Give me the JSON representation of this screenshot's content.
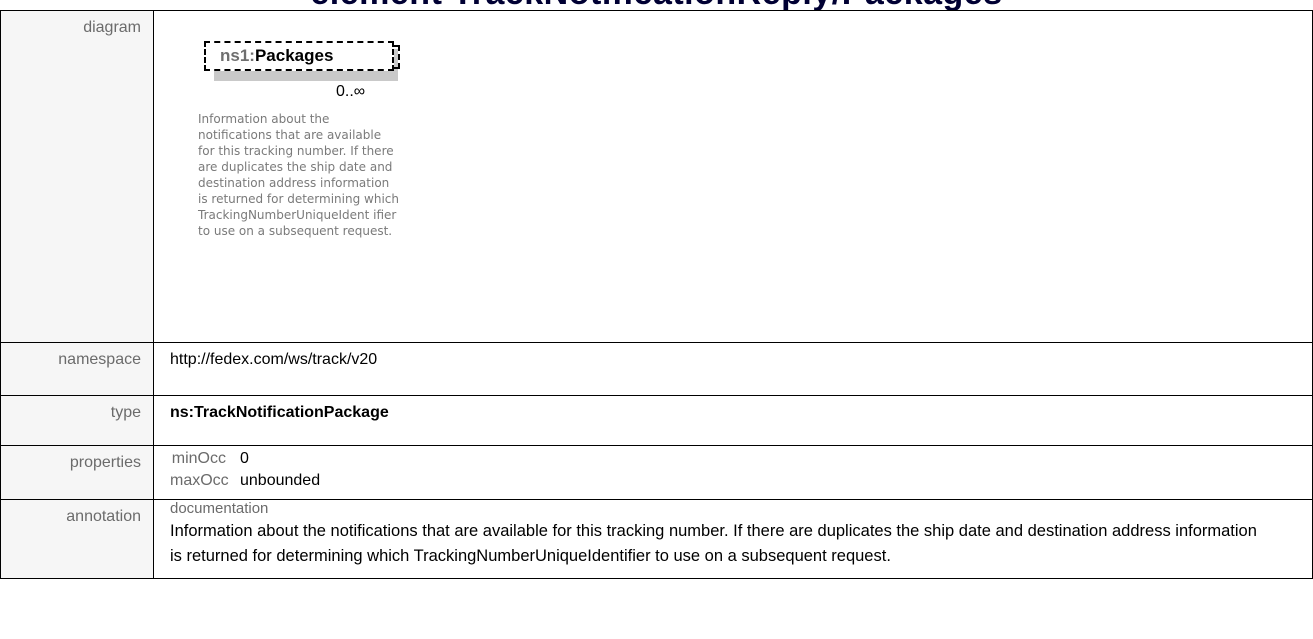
{
  "heading": {
    "prefix": "element TrackNotificationReply/Packages",
    "accent": ""
  },
  "rows": {
    "diagram": {
      "label": "diagram",
      "node_prefix": "ns1:",
      "node_name": "Packages",
      "cardinality": "0..∞",
      "node_doc": "Information about the notifications that are available for this tracking number. If there are duplicates the ship date and destination address information is returned for determining which TrackingNumberUniqueIdent ifier to use on a subsequent request."
    },
    "namespace": {
      "label": "namespace",
      "value": "http://fedex.com/ws/track/v20"
    },
    "type": {
      "label": "type",
      "value": "ns:TrackNotificationPackage"
    },
    "properties": {
      "label": "properties",
      "items": [
        {
          "name": "minOcc",
          "value": "0"
        },
        {
          "name": "maxOcc",
          "value": "unbounded"
        }
      ]
    },
    "annotation": {
      "label": "annotation",
      "doc_label": "documentation",
      "doc_text": "Information about the notifications that are available for this tracking number. If there are duplicates the ship date and destination address information is returned for determining which TrackingNumberUniqueIdentifier to use on a subsequent request."
    }
  }
}
